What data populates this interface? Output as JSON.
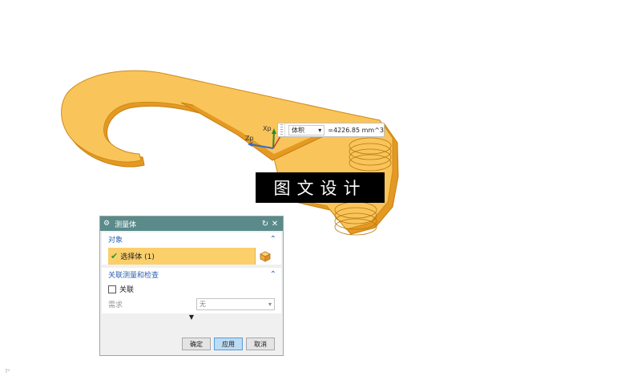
{
  "viewport": {
    "axis_labels": {
      "xp": "Xp",
      "zp": "Zp"
    },
    "colors": {
      "part": "#f9c55a",
      "part_dark": "#e49a22",
      "part_edge": "#c67d12"
    }
  },
  "readout": {
    "type_label": "体积",
    "value": "=4226.85 mm^3"
  },
  "banner": {
    "text": "图文设计"
  },
  "dialog": {
    "title": "测量体",
    "objects_section": {
      "header": "对象",
      "select_label": "选择体 (1)"
    },
    "assoc_section": {
      "header": "关联测量和检查",
      "associate_label": "关联",
      "requirement_label": "需求",
      "requirement_value": "无"
    },
    "buttons": {
      "ok": "确定",
      "apply": "应用",
      "cancel": "取消"
    }
  },
  "corner_text": "7⁰"
}
